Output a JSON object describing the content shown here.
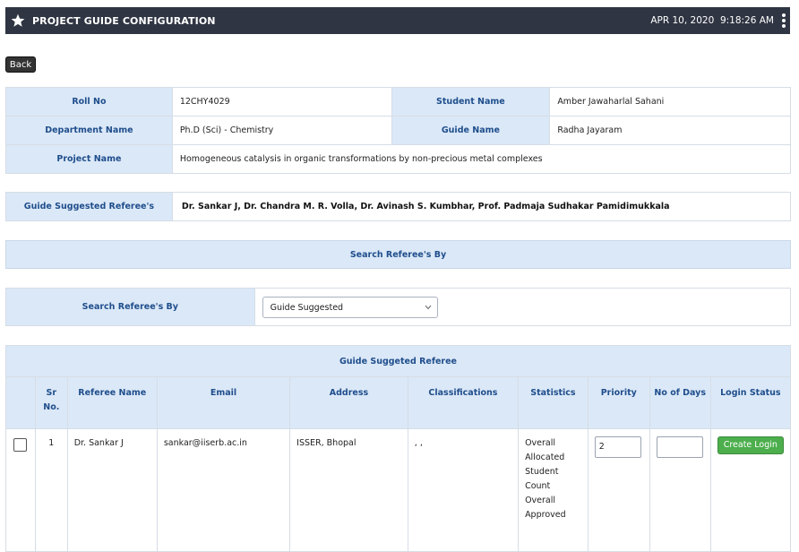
{
  "header": {
    "title": "PROJECT GUIDE CONFIGURATION",
    "date": "APR 10, 2020",
    "time": "9:18:26 AM"
  },
  "back_label": "Back",
  "info": {
    "roll_no_label": "Roll No",
    "roll_no": "12CHY4029",
    "student_name_label": "Student Name",
    "student_name": "Amber Jawaharlal Sahani",
    "department_label": "Department Name",
    "department": "Ph.D (Sci) - Chemistry",
    "guide_name_label": "Guide Name",
    "guide_name": "Radha Jayaram",
    "project_label": "Project Name",
    "project": "Homogeneous catalysis in organic transformations by non-precious metal complexes"
  },
  "guide_suggested": {
    "label": "Guide Suggested Referee's",
    "names": "Dr. Sankar J,  Dr. Chandra M. R. Volla,  Dr. Avinash S. Kumbhar,  Prof. Padmaja Sudhakar Pamidimukkala"
  },
  "search_band_title": "Search Referee's By",
  "search": {
    "label": "Search Referee's By",
    "selected": "Guide Suggested"
  },
  "referee_table": {
    "caption": "Guide Suggeted Referee",
    "headers": {
      "sr": "Sr No.",
      "name": "Referee Name",
      "email": "Email",
      "address": "Address",
      "classifications": "Classifications",
      "statistics": "Statistics",
      "priority": "Priority",
      "days": "No of Days",
      "login": "Login Status"
    },
    "rows": [
      {
        "sr": "1",
        "name": "Dr. Sankar J",
        "email": "sankar@iiserb.ac.in",
        "address": "ISSER, Bhopal",
        "classifications": ", ,",
        "statistics": "Overall Allocated Student Count Overall Approved",
        "priority": "2",
        "days": "",
        "login_button": "Create Login"
      }
    ]
  },
  "colors": {
    "header_bg": "#2f3542",
    "label_bg": "#dbe8f7",
    "label_text": "#1f4e8c",
    "button_green": "#4cae4c"
  },
  "icons": [
    "star-icon",
    "kebab-menu-icon",
    "chevron-down-icon",
    "checkbox"
  ]
}
